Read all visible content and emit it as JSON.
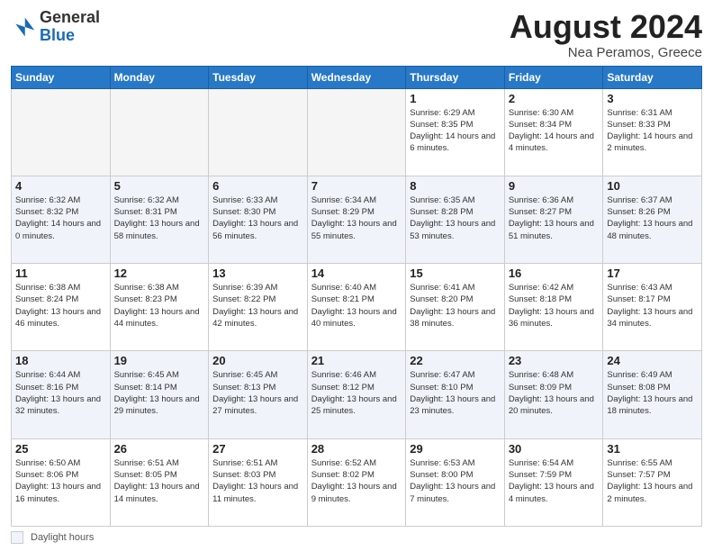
{
  "header": {
    "logo_general": "General",
    "logo_blue": "Blue",
    "main_title": "August 2024",
    "subtitle": "Nea Peramos, Greece"
  },
  "legend": {
    "label": "Daylight hours"
  },
  "columns": [
    "Sunday",
    "Monday",
    "Tuesday",
    "Wednesday",
    "Thursday",
    "Friday",
    "Saturday"
  ],
  "weeks": [
    [
      {
        "num": "",
        "info": ""
      },
      {
        "num": "",
        "info": ""
      },
      {
        "num": "",
        "info": ""
      },
      {
        "num": "",
        "info": ""
      },
      {
        "num": "1",
        "info": "Sunrise: 6:29 AM\nSunset: 8:35 PM\nDaylight: 14 hours\nand 6 minutes."
      },
      {
        "num": "2",
        "info": "Sunrise: 6:30 AM\nSunset: 8:34 PM\nDaylight: 14 hours\nand 4 minutes."
      },
      {
        "num": "3",
        "info": "Sunrise: 6:31 AM\nSunset: 8:33 PM\nDaylight: 14 hours\nand 2 minutes."
      }
    ],
    [
      {
        "num": "4",
        "info": "Sunrise: 6:32 AM\nSunset: 8:32 PM\nDaylight: 14 hours\nand 0 minutes."
      },
      {
        "num": "5",
        "info": "Sunrise: 6:32 AM\nSunset: 8:31 PM\nDaylight: 13 hours\nand 58 minutes."
      },
      {
        "num": "6",
        "info": "Sunrise: 6:33 AM\nSunset: 8:30 PM\nDaylight: 13 hours\nand 56 minutes."
      },
      {
        "num": "7",
        "info": "Sunrise: 6:34 AM\nSunset: 8:29 PM\nDaylight: 13 hours\nand 55 minutes."
      },
      {
        "num": "8",
        "info": "Sunrise: 6:35 AM\nSunset: 8:28 PM\nDaylight: 13 hours\nand 53 minutes."
      },
      {
        "num": "9",
        "info": "Sunrise: 6:36 AM\nSunset: 8:27 PM\nDaylight: 13 hours\nand 51 minutes."
      },
      {
        "num": "10",
        "info": "Sunrise: 6:37 AM\nSunset: 8:26 PM\nDaylight: 13 hours\nand 48 minutes."
      }
    ],
    [
      {
        "num": "11",
        "info": "Sunrise: 6:38 AM\nSunset: 8:24 PM\nDaylight: 13 hours\nand 46 minutes."
      },
      {
        "num": "12",
        "info": "Sunrise: 6:38 AM\nSunset: 8:23 PM\nDaylight: 13 hours\nand 44 minutes."
      },
      {
        "num": "13",
        "info": "Sunrise: 6:39 AM\nSunset: 8:22 PM\nDaylight: 13 hours\nand 42 minutes."
      },
      {
        "num": "14",
        "info": "Sunrise: 6:40 AM\nSunset: 8:21 PM\nDaylight: 13 hours\nand 40 minutes."
      },
      {
        "num": "15",
        "info": "Sunrise: 6:41 AM\nSunset: 8:20 PM\nDaylight: 13 hours\nand 38 minutes."
      },
      {
        "num": "16",
        "info": "Sunrise: 6:42 AM\nSunset: 8:18 PM\nDaylight: 13 hours\nand 36 minutes."
      },
      {
        "num": "17",
        "info": "Sunrise: 6:43 AM\nSunset: 8:17 PM\nDaylight: 13 hours\nand 34 minutes."
      }
    ],
    [
      {
        "num": "18",
        "info": "Sunrise: 6:44 AM\nSunset: 8:16 PM\nDaylight: 13 hours\nand 32 minutes."
      },
      {
        "num": "19",
        "info": "Sunrise: 6:45 AM\nSunset: 8:14 PM\nDaylight: 13 hours\nand 29 minutes."
      },
      {
        "num": "20",
        "info": "Sunrise: 6:45 AM\nSunset: 8:13 PM\nDaylight: 13 hours\nand 27 minutes."
      },
      {
        "num": "21",
        "info": "Sunrise: 6:46 AM\nSunset: 8:12 PM\nDaylight: 13 hours\nand 25 minutes."
      },
      {
        "num": "22",
        "info": "Sunrise: 6:47 AM\nSunset: 8:10 PM\nDaylight: 13 hours\nand 23 minutes."
      },
      {
        "num": "23",
        "info": "Sunrise: 6:48 AM\nSunset: 8:09 PM\nDaylight: 13 hours\nand 20 minutes."
      },
      {
        "num": "24",
        "info": "Sunrise: 6:49 AM\nSunset: 8:08 PM\nDaylight: 13 hours\nand 18 minutes."
      }
    ],
    [
      {
        "num": "25",
        "info": "Sunrise: 6:50 AM\nSunset: 8:06 PM\nDaylight: 13 hours\nand 16 minutes."
      },
      {
        "num": "26",
        "info": "Sunrise: 6:51 AM\nSunset: 8:05 PM\nDaylight: 13 hours\nand 14 minutes."
      },
      {
        "num": "27",
        "info": "Sunrise: 6:51 AM\nSunset: 8:03 PM\nDaylight: 13 hours\nand 11 minutes."
      },
      {
        "num": "28",
        "info": "Sunrise: 6:52 AM\nSunset: 8:02 PM\nDaylight: 13 hours\nand 9 minutes."
      },
      {
        "num": "29",
        "info": "Sunrise: 6:53 AM\nSunset: 8:00 PM\nDaylight: 13 hours\nand 7 minutes."
      },
      {
        "num": "30",
        "info": "Sunrise: 6:54 AM\nSunset: 7:59 PM\nDaylight: 13 hours\nand 4 minutes."
      },
      {
        "num": "31",
        "info": "Sunrise: 6:55 AM\nSunset: 7:57 PM\nDaylight: 13 hours\nand 2 minutes."
      }
    ]
  ]
}
